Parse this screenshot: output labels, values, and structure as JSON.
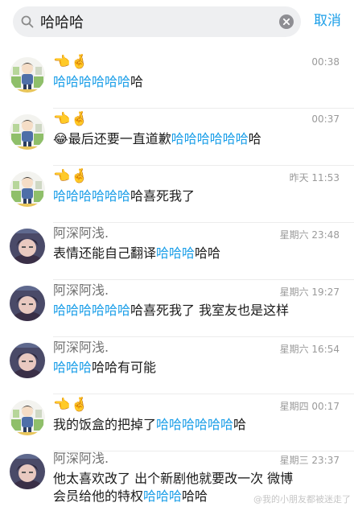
{
  "search": {
    "value": "哈哈哈",
    "cancel_label": "取消"
  },
  "results": [
    {
      "name": "👈🤞",
      "name_style": "emoji",
      "avatar": "cartoon",
      "time": "00:38",
      "line1": [
        {
          "t": "哈哈哈哈哈哈",
          "hl": true
        },
        {
          "t": "哈",
          "hl": false
        }
      ]
    },
    {
      "name": "👈🤞",
      "name_style": "emoji",
      "avatar": "cartoon",
      "time": "00:37",
      "line1": [
        {
          "t": "😂最后还要一直道歉",
          "hl": false
        },
        {
          "t": "哈哈哈哈哈哈",
          "hl": true
        },
        {
          "t": "哈",
          "hl": false
        }
      ]
    },
    {
      "name": "👈🤞",
      "name_style": "emoji",
      "avatar": "cartoon",
      "time": "昨天 11:53",
      "line1": [
        {
          "t": "哈哈哈哈哈哈",
          "hl": true
        },
        {
          "t": "哈喜死我了",
          "hl": false
        }
      ]
    },
    {
      "name": "阿深阿浅.",
      "name_style": "text",
      "avatar": "photo",
      "time": "星期六 23:48",
      "line1": [
        {
          "t": "表情还能自己翻译",
          "hl": false
        },
        {
          "t": "哈哈哈",
          "hl": true
        },
        {
          "t": "哈哈",
          "hl": false
        }
      ]
    },
    {
      "name": "阿深阿浅.",
      "name_style": "text",
      "avatar": "photo",
      "time": "星期六 19:27",
      "line1": [
        {
          "t": "哈哈哈哈哈哈",
          "hl": true
        },
        {
          "t": "哈喜死我了 我室友也是这样",
          "hl": false
        }
      ]
    },
    {
      "name": "阿深阿浅.",
      "name_style": "text",
      "avatar": "photo",
      "time": "星期六 16:54",
      "line1": [
        {
          "t": "哈哈哈",
          "hl": true
        },
        {
          "t": "哈哈有可能",
          "hl": false
        }
      ]
    },
    {
      "name": "👈🤞",
      "name_style": "emoji",
      "avatar": "cartoon",
      "time": "星期四 00:17",
      "line1": [
        {
          "t": "我的饭盒的把掉了",
          "hl": false
        },
        {
          "t": "哈哈哈哈哈哈",
          "hl": true
        },
        {
          "t": "哈",
          "hl": false
        }
      ]
    },
    {
      "name": "阿深阿浅.",
      "name_style": "text",
      "avatar": "photo",
      "time": "星期三 23:37",
      "line1": [
        {
          "t": "他太喜欢改了 出个新剧他就要改一次 微博",
          "hl": false
        }
      ],
      "line2": [
        {
          "t": "会员给他的特权",
          "hl": false
        },
        {
          "t": "哈哈哈",
          "hl": true
        },
        {
          "t": "哈哈",
          "hl": false
        }
      ]
    }
  ],
  "watermark": "@我的小朋友都被迷走了",
  "colors": {
    "highlight": "#1a9ee8",
    "time": "#9a9a9a",
    "name": "#707070",
    "search_bg": "#eeeff1"
  }
}
